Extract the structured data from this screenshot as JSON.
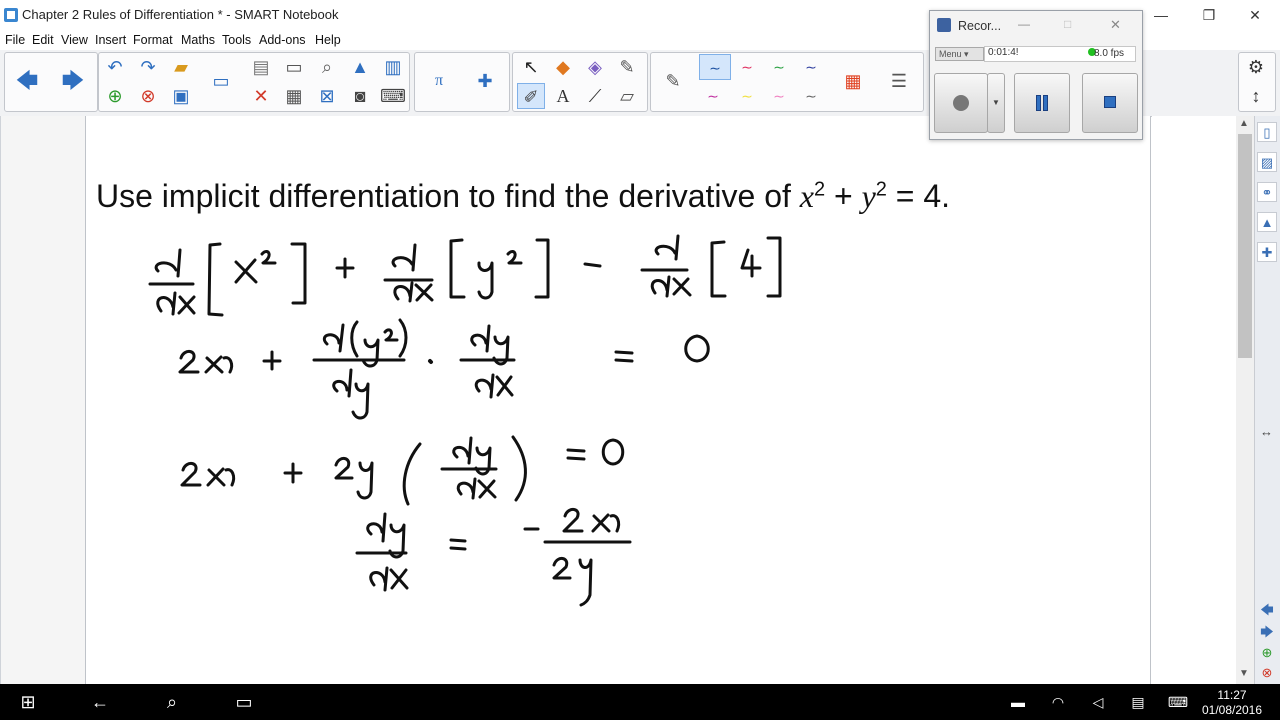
{
  "window": {
    "title": "Chapter 2 Rules of Differentiation * - SMART Notebook",
    "minimize": "—",
    "maximize": "❐",
    "close": "✕"
  },
  "menu": [
    "File",
    "Edit",
    "View",
    "Insert",
    "Format",
    "Maths",
    "Tools",
    "Add-ons",
    "Help"
  ],
  "toolbar": {
    "icons": [
      "back-arrow-icon",
      "forward-arrow-icon",
      "undo-icon",
      "redo-icon",
      "open-folder-icon",
      "add-page-icon",
      "delete-page-icon",
      "save-icon",
      "screen-icon",
      "paste-icon",
      "screenshade-icon",
      "document-camera-icon",
      "table-icon",
      "maths-tools-icon",
      "add-ons-icon",
      "select-icon",
      "shapes-icon",
      "eraser-icon",
      "pen-icon",
      "text-icon",
      "line-icon",
      "color-palette-icon",
      "properties-icon",
      "settings-icon",
      "move-toolbar-icon"
    ],
    "accent_color": "#2f6fc0",
    "selected_color": "#d4e6fb"
  },
  "heading": {
    "prefix": "Use implicit differentiation to find the derivative of ",
    "x": "x",
    "plus": " + ",
    "y": "y",
    "exp1": "2",
    "exp2": "2",
    "equals": " = 4."
  },
  "recorder": {
    "title": "Recor...",
    "menu_label": "Menu ▾",
    "time": "0:01:4!",
    "fps": "8.0 fps",
    "status_color": "#20c020"
  },
  "taskbar": {
    "time": "11:27",
    "date": "01/08/2016"
  }
}
